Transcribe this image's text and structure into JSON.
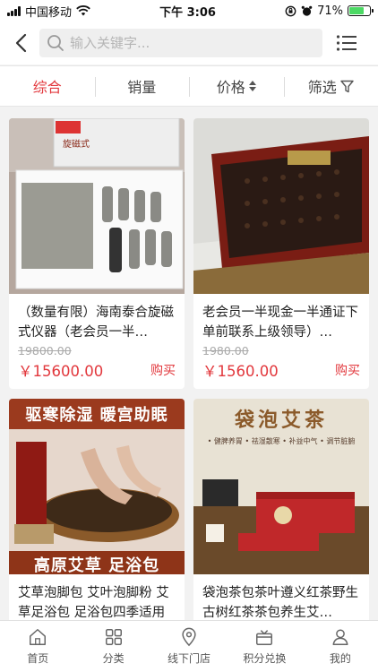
{
  "status": {
    "carrier": "中国移动",
    "time": "下午 3:06",
    "battery": "71%",
    "battery_level": 0.71
  },
  "search": {
    "placeholder": "输入关键字..."
  },
  "sort_tabs": [
    {
      "label": "综合",
      "active": true
    },
    {
      "label": "销量",
      "active": false
    },
    {
      "label": "价格",
      "active": false
    },
    {
      "label": "筛选",
      "active": false
    }
  ],
  "products": [
    {
      "title": "（数量有限）海南泰合旋磁式仪器（老会员一半…",
      "old_price": "19800.00",
      "price": "￥15600.00",
      "buy": "购买",
      "image_text": "旋磁式"
    },
    {
      "title": "老会员一半现金一半通证下单前联系上级领导）…",
      "old_price": "1980.00",
      "price": "￥1560.00",
      "buy": "购买",
      "image_text": ""
    },
    {
      "title": "艾草泡脚包 艾叶泡脚粉 艾草足浴包 足浴包四季适用",
      "old_price": "",
      "price": "",
      "buy": "",
      "image_text": {
        "top": "驱寒除湿  暖宫助眠",
        "bottom": "高原艾草  足浴包"
      }
    },
    {
      "title": "袋泡茶包茶叶遵义红茶野生古树红茶茶包养生艾…",
      "old_price": "",
      "price": "",
      "buy": "",
      "image_text": {
        "top": "袋泡艾茶",
        "sub": "• 健脾养胃 • 祛湿散寒 • 补益中气 • 调节脏腑"
      }
    }
  ],
  "tabbar": [
    {
      "label": "首页",
      "icon": "home-icon"
    },
    {
      "label": "分类",
      "icon": "category-icon"
    },
    {
      "label": "线下门店",
      "icon": "location-icon"
    },
    {
      "label": "积分兑换",
      "icon": "gift-icon"
    },
    {
      "label": "我的",
      "icon": "user-icon"
    }
  ],
  "colors": {
    "accent": "#e2383d",
    "background": "#f2f2f2"
  }
}
